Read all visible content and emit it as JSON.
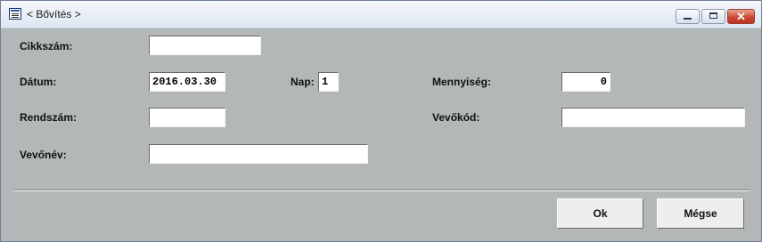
{
  "window": {
    "title": "< Bővítés >"
  },
  "form": {
    "cikkszam": {
      "label": "Cikkszám:",
      "value": ""
    },
    "datum": {
      "label": "Dátum:",
      "value": "2016.03.30"
    },
    "nap": {
      "label": "Nap:",
      "value": "1"
    },
    "mennyiseg": {
      "label": "Mennyiség:",
      "value": "0"
    },
    "rendszam": {
      "label": "Rendszám:",
      "value": ""
    },
    "vevokod": {
      "label": "Vevőkód:",
      "value": ""
    },
    "vevonev": {
      "label": "Vevőnév:",
      "value": ""
    }
  },
  "buttons": {
    "ok": "Ok",
    "cancel": "Mégse"
  },
  "icons": {
    "app": "app-window-icon",
    "minimize": "minimize-icon",
    "maximize": "maximize-icon",
    "close": "close-icon"
  },
  "colors": {
    "dialog_background": "#b3b7b7",
    "close_button": "#c94a33"
  }
}
